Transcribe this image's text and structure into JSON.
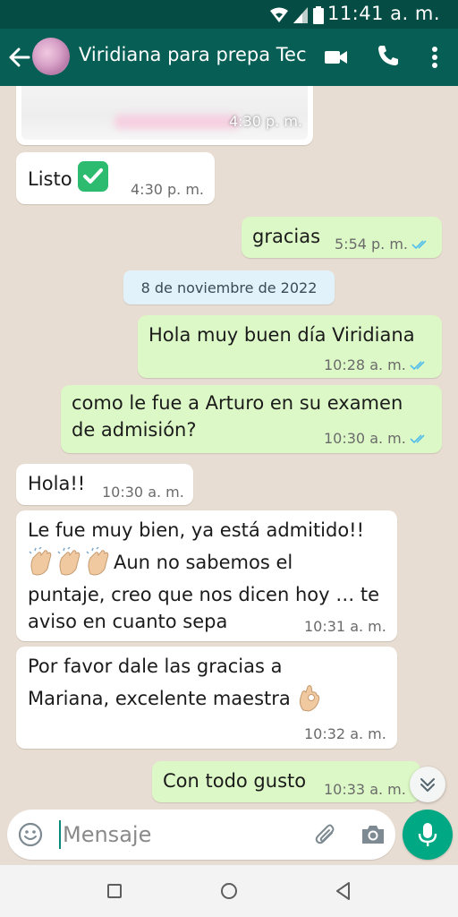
{
  "status_bar": {
    "time": "11:41 a. m."
  },
  "header": {
    "contact_name": "Viridiana para prepa Tec"
  },
  "messages": [
    {
      "id": 1,
      "direction": "in",
      "text": "",
      "time": "4:30 p. m."
    },
    {
      "id": 2,
      "direction": "in",
      "text": "Listo",
      "emoji": "check-mark-button",
      "time": "4:30 p. m."
    },
    {
      "id": 3,
      "direction": "out",
      "text": "gracias",
      "time": "5:54 p. m.",
      "status": "read"
    },
    {
      "id": 4,
      "direction": "out",
      "text": "Hola muy buen día Viridiana",
      "time": "10:28 a. m.",
      "status": "read"
    },
    {
      "id": 5,
      "direction": "out",
      "lines": [
        "como le fue a Arturo en su examen",
        "de admisión?"
      ],
      "time": "10:30 a. m.",
      "status": "read"
    },
    {
      "id": 6,
      "direction": "in",
      "text": "Hola!!",
      "time": "10:30 a. m."
    },
    {
      "id": 7,
      "direction": "in",
      "lines": [
        "Le fue muy bien, ya está admitido!!",
        "Aun no sabemos el",
        "puntaje, creo que nos dicen hoy … te",
        "aviso en cuanto sepa"
      ],
      "emoji": "clapping-hands",
      "time": "10:31 a. m."
    },
    {
      "id": 8,
      "direction": "in",
      "lines": [
        "Por favor dale las gracias a",
        "Mariana, excelente maestra"
      ],
      "emoji": "ok-hand",
      "time": "10:32 a. m."
    },
    {
      "id": 9,
      "direction": "out",
      "text": "Con todo gusto",
      "time": "10:33 a. m.",
      "status": "read"
    }
  ],
  "date_separator": "8 de noviembre de 2022",
  "composer": {
    "placeholder": "Mensaje"
  },
  "colors": {
    "header": "#075e54",
    "status_bar": "#054d44",
    "outgoing": "#dcf8c6",
    "incoming": "#ffffff",
    "read_ticks": "#53bdeb",
    "send_button": "#00a884"
  }
}
